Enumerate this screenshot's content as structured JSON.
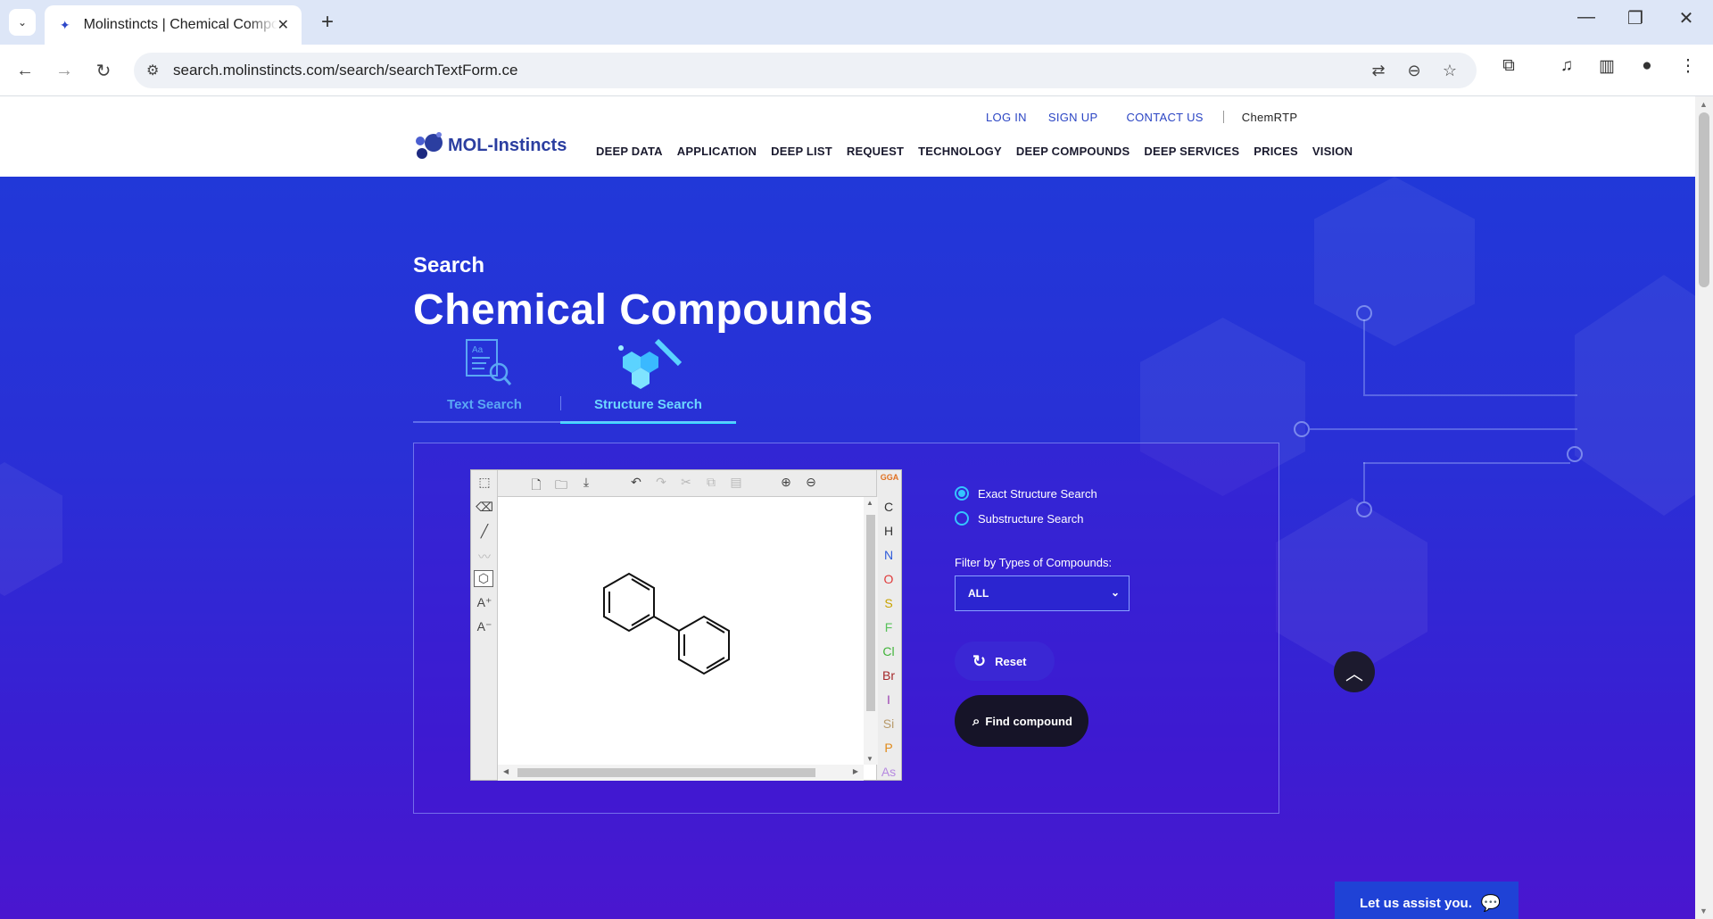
{
  "browser": {
    "tab_title": "Molinstincts | Chemical Compounds",
    "url": "search.molinstincts.com/search/searchTextForm.ce",
    "controls": {
      "minimize": "—",
      "restore": "❐",
      "close": "✕",
      "new_tab": "+",
      "tab_close": "✕"
    }
  },
  "header": {
    "top_links": [
      "LOG IN",
      "SIGN UP",
      "CONTACT US",
      "ChemRTP"
    ],
    "logo_text": "MOL-Instincts",
    "nav": [
      "DEEP DATA",
      "APPLICATION",
      "DEEP LIST",
      "REQUEST",
      "TECHNOLOGY",
      "DEEP COMPOUNDS",
      "DEEP SERVICES",
      "PRICES",
      "VISION"
    ]
  },
  "hero": {
    "search_label": "Search",
    "title": "Chemical Compounds"
  },
  "search_tabs": [
    {
      "label": "Text Search",
      "active": false
    },
    {
      "label": "Structure Search",
      "active": true
    }
  ],
  "editor": {
    "elements": [
      "C",
      "H",
      "N",
      "O",
      "S",
      "F",
      "Cl",
      "Br",
      "I",
      "Si",
      "P",
      "As"
    ],
    "element_colors": [
      "#333333",
      "#333333",
      "#2f5bd9",
      "#e03a3a",
      "#c9a300",
      "#59c25b",
      "#41b43a",
      "#a5282a",
      "#9a3fb0",
      "#b89a6a",
      "#e08a1a",
      "#b68ae0"
    ],
    "brand": "GGA",
    "molecule": "biphenyl"
  },
  "options": {
    "radio": [
      {
        "label": "Exact Structure Search",
        "checked": true
      },
      {
        "label": "Substructure Search",
        "checked": false
      }
    ],
    "filter_label": "Filter by Types of Compounds:",
    "filter_value": "ALL",
    "reset_label": "Reset",
    "find_label": "Find compound"
  },
  "assist_label": "Let us assist you."
}
